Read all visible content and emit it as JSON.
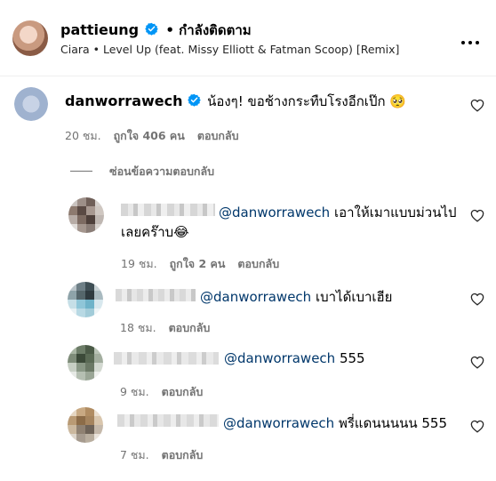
{
  "header": {
    "username": "pattieung",
    "status": "• กำลังติดตาม",
    "song": "Ciara • Level Up (feat. Missy Elliott & Fatman Scoop) [Remix]",
    "more_icon": "more-horizontal-icon"
  },
  "main_comment": {
    "username": "danworrawech",
    "text": "น้องๆ! ขอช้างกระทืบโรงอีกเป๊ก",
    "emoji": "🥺",
    "time": "20 ชม.",
    "likes": "ถูกใจ 406 คน",
    "reply": "ตอบกลับ",
    "hide_replies": "ซ่อนข้อความตอบกลับ"
  },
  "replies": [
    {
      "mention": "@danworrawech",
      "text_line1": "เอาให้เมาแบบม่วนไป",
      "text_line2": "เลยคร๊าบ",
      "emoji": "😂",
      "time": "19 ชม.",
      "likes": "ถูกใจ 2 คน",
      "reply": "ตอบกลับ"
    },
    {
      "mention": "@danworrawech",
      "text": "เบาได้เบาเฮีย",
      "time": "18 ชม.",
      "reply": "ตอบกลับ"
    },
    {
      "mention": "@danworrawech",
      "text": "555",
      "time": "9 ชม.",
      "reply": "ตอบกลับ"
    },
    {
      "mention": "@danworrawech",
      "text": "พรี่แดนนนนน 555",
      "time": "7 ชม.",
      "reply": "ตอบกลับ"
    }
  ],
  "colors": {
    "verified": "#0095f6",
    "mention": "#00376b",
    "muted": "#737373"
  }
}
